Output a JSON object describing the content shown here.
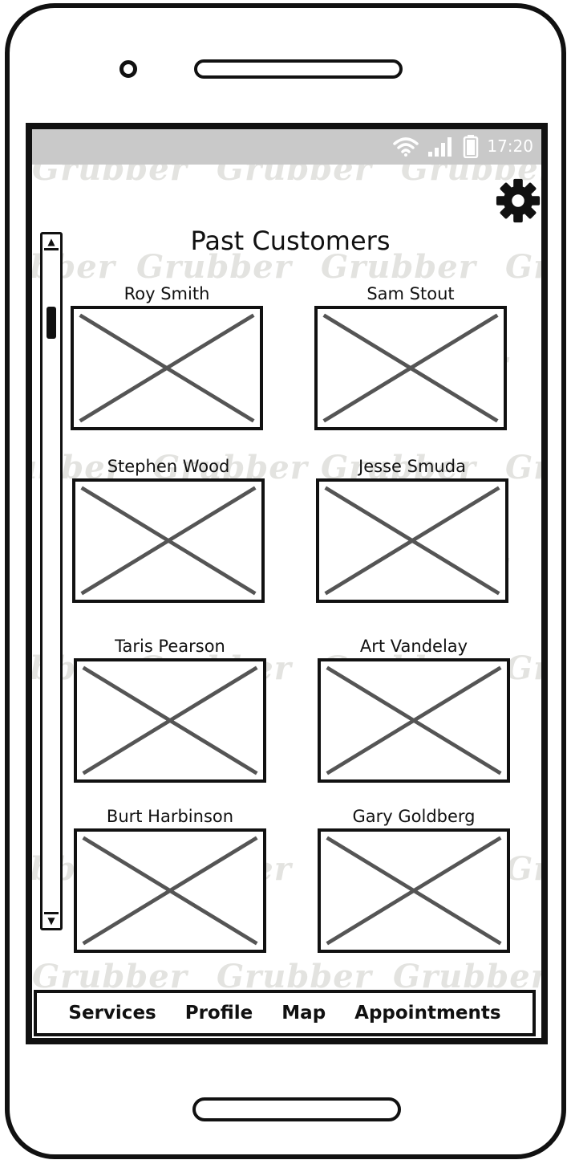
{
  "status_bar": {
    "time": "17:20",
    "icons": [
      "wifi-icon",
      "signal-icon",
      "battery-icon"
    ]
  },
  "watermark_text": "Grubber",
  "header": {
    "title": "Past Customers",
    "settings_icon": "gear-icon"
  },
  "customers": [
    {
      "name": "Roy Smith"
    },
    {
      "name": "Sam Stout"
    },
    {
      "name": "Stephen Wood"
    },
    {
      "name": "Jesse Smuda"
    },
    {
      "name": "Taris Pearson"
    },
    {
      "name": "Art Vandelay"
    },
    {
      "name": "Burt Harbinson"
    },
    {
      "name": "Gary Goldberg"
    }
  ],
  "nav": {
    "services": "Services",
    "profile": "Profile",
    "map": "Map",
    "appointments": "Appointments"
  },
  "colors": {
    "frame": "#111111",
    "status_bar": "#c9c9c9",
    "watermark": "#e3e3e0",
    "placeholder_x": "#555555"
  }
}
